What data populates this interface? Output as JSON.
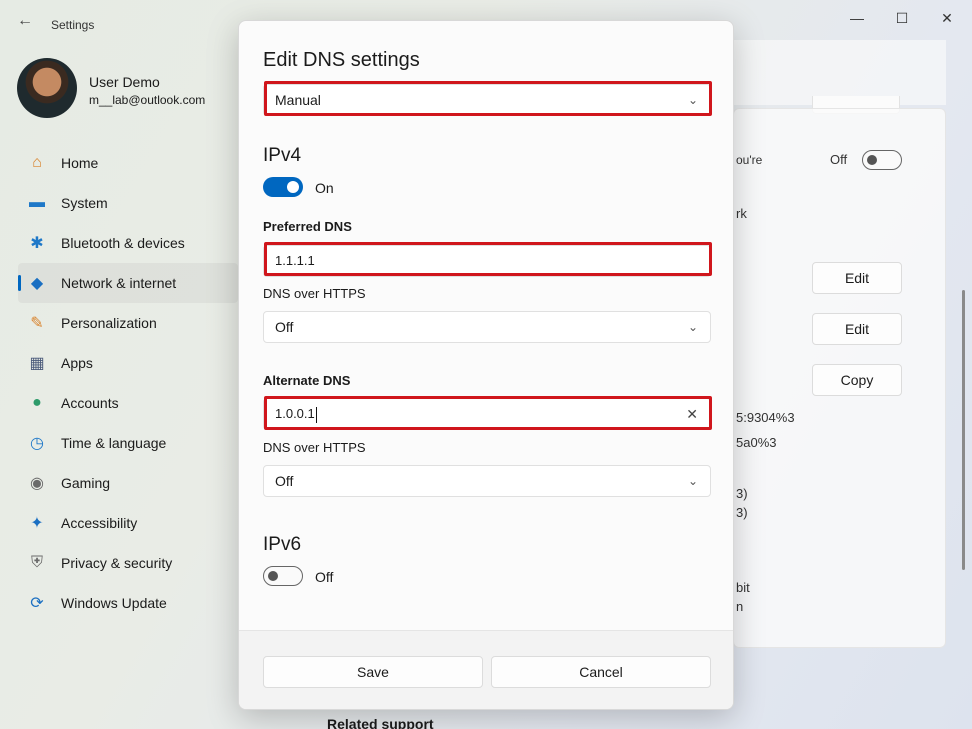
{
  "window": {
    "app_title": "Settings",
    "back_icon": "←",
    "minimize_icon": "—",
    "maximize_icon": "☐",
    "close_icon": "✕"
  },
  "profile": {
    "name": "User Demo",
    "email": "m__lab@outlook.com"
  },
  "sidebar": {
    "active": "Network & internet",
    "items": [
      {
        "label": "Home",
        "icon": "home-icon",
        "glyph": "⌂",
        "color": "#d9822b"
      },
      {
        "label": "System",
        "icon": "monitor-icon",
        "glyph": "▬",
        "color": "#1e78c8"
      },
      {
        "label": "Bluetooth & devices",
        "icon": "bluetooth-icon",
        "glyph": "✱",
        "color": "#1e78c8"
      },
      {
        "label": "Network & internet",
        "icon": "wifi-icon",
        "glyph": "◆",
        "color": "#1a6fc2"
      },
      {
        "label": "Personalization",
        "icon": "brush-icon",
        "glyph": "✎",
        "color": "#d9822b"
      },
      {
        "label": "Apps",
        "icon": "apps-icon",
        "glyph": "▦",
        "color": "#4a5a7a"
      },
      {
        "label": "Accounts",
        "icon": "accounts-icon",
        "glyph": "●",
        "color": "#2e9b6a"
      },
      {
        "label": "Time & language",
        "icon": "clock-globe-icon",
        "glyph": "◷",
        "color": "#1e78c8"
      },
      {
        "label": "Gaming",
        "icon": "gamepad-icon",
        "glyph": "◉",
        "color": "#6a6a6a"
      },
      {
        "label": "Accessibility",
        "icon": "accessibility-icon",
        "glyph": "✦",
        "color": "#1a6fc2"
      },
      {
        "label": "Privacy & security",
        "icon": "shield-icon",
        "glyph": "⛨",
        "color": "#6a6a6a"
      },
      {
        "label": "Windows Update",
        "icon": "update-icon",
        "glyph": "⟳",
        "color": "#1a6fc2"
      }
    ]
  },
  "background_content": {
    "notice_fragment": "ou're",
    "metered_toggle_label": "Off",
    "link_fragment": "rk",
    "edit_label_1": "Edit",
    "edit_label_2": "Edit",
    "copy_label": "Copy",
    "ipv6_fragment_1": "5:9304%3",
    "ipv6_fragment_2": "5a0%3",
    "paren_fragment_1": "3)",
    "paren_fragment_2": "3)",
    "speed_fragment": "bit",
    "n_fragment": "n",
    "related_support": "Related support"
  },
  "dialog": {
    "title": "Edit DNS settings",
    "mode_value": "Manual",
    "ipv4": {
      "heading": "IPv4",
      "toggle_state": "On",
      "preferred_label": "Preferred DNS",
      "preferred_value": "1.1.1.1",
      "preferred_doh_label": "DNS over HTTPS",
      "preferred_doh_value": "Off",
      "alternate_label": "Alternate DNS",
      "alternate_value": "1.0.0.1",
      "alternate_doh_label": "DNS over HTTPS",
      "alternate_doh_value": "Off"
    },
    "ipv6": {
      "heading": "IPv6",
      "toggle_state": "Off"
    },
    "save_label": "Save",
    "cancel_label": "Cancel",
    "chevron_icon": "⌄",
    "clear_icon": "✕"
  },
  "colors": {
    "accent": "#0067c0",
    "highlight": "#d0161c"
  }
}
